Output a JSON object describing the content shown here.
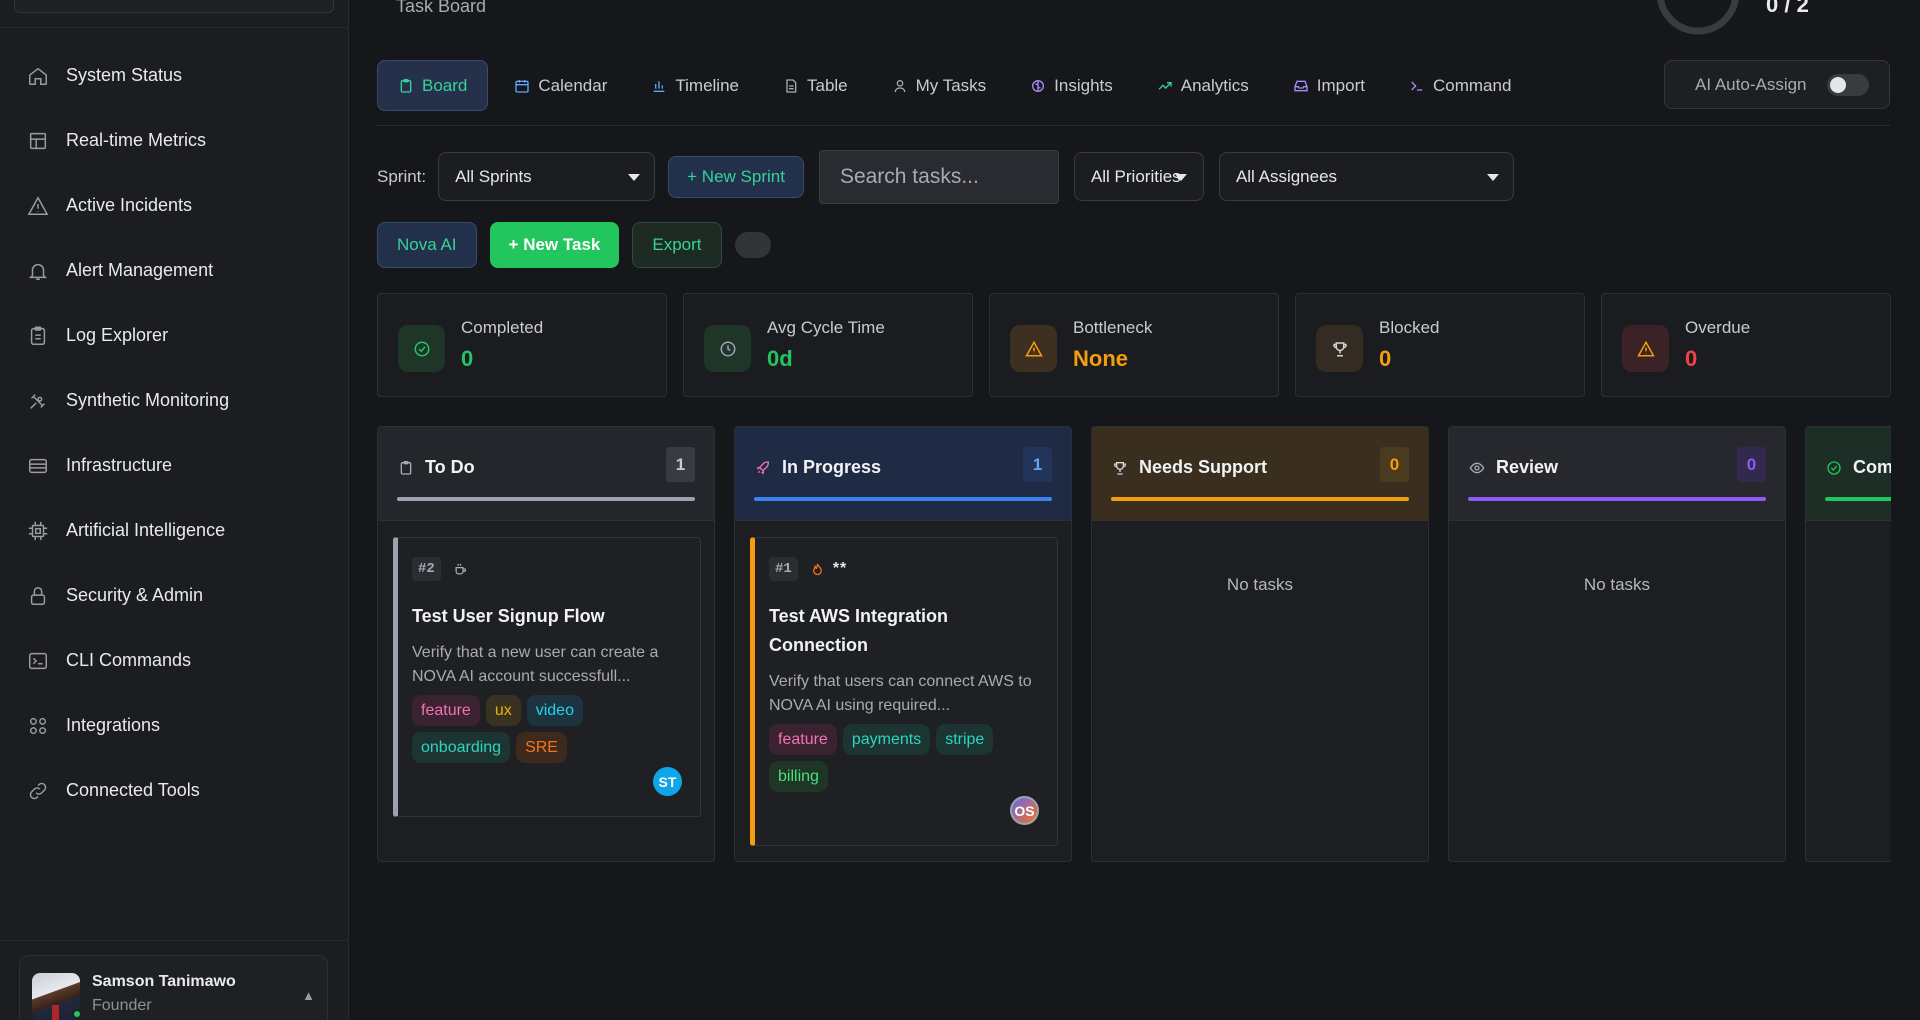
{
  "page": {
    "title": "Task Board",
    "progress_text": "0 / 2",
    "progress_fraction": 0
  },
  "sidebar": {
    "items": [
      {
        "label": "System Status",
        "icon": "home-icon"
      },
      {
        "label": "Real-time Metrics",
        "icon": "layout-icon"
      },
      {
        "label": "Active Incidents",
        "icon": "warning-icon"
      },
      {
        "label": "Alert Management",
        "icon": "bell-icon"
      },
      {
        "label": "Log Explorer",
        "icon": "clipboard-icon"
      },
      {
        "label": "Synthetic Monitoring",
        "icon": "satellite-icon"
      },
      {
        "label": "Infrastructure",
        "icon": "server-icon"
      },
      {
        "label": "Artificial Intelligence",
        "icon": "cpu-icon"
      },
      {
        "label": "Security & Admin",
        "icon": "lock-icon"
      },
      {
        "label": "CLI Commands",
        "icon": "terminal-icon"
      },
      {
        "label": "Integrations",
        "icon": "grid-icon"
      },
      {
        "label": "Connected Tools",
        "icon": "link-icon"
      }
    ],
    "user": {
      "name": "Samson Tanimawo",
      "role": "Founder"
    }
  },
  "tabs": [
    {
      "label": "Board",
      "icon": "clipboard-icon",
      "active": true
    },
    {
      "label": "Calendar",
      "icon": "calendar-icon",
      "active": false
    },
    {
      "label": "Timeline",
      "icon": "bar-chart-icon",
      "active": false
    },
    {
      "label": "Table",
      "icon": "document-icon",
      "active": false
    },
    {
      "label": "My Tasks",
      "icon": "user-icon",
      "active": false
    },
    {
      "label": "Insights",
      "icon": "brain-icon",
      "active": false
    },
    {
      "label": "Analytics",
      "icon": "trend-icon",
      "active": false
    },
    {
      "label": "Import",
      "icon": "inbox-icon",
      "active": false
    },
    {
      "label": "Command",
      "icon": "prompt-icon",
      "active": false
    }
  ],
  "auto_assign": {
    "label": "AI Auto-Assign",
    "enabled": false
  },
  "filters": {
    "sprint_label": "Sprint:",
    "sprint_value": "All Sprints",
    "new_sprint": "+ New Sprint",
    "search_placeholder": "Search tasks...",
    "priority_value": "All Priorities",
    "assignee_value": "All Assignees"
  },
  "actions": {
    "nova": "Nova AI",
    "new_task": "+ New Task",
    "export": "Export"
  },
  "stats": [
    {
      "label": "Completed",
      "value": "0",
      "color": "#22c55e",
      "icon": "check-circle-icon"
    },
    {
      "label": "Avg Cycle Time",
      "value": "0d",
      "color": "#22c55e",
      "icon": "clock-icon"
    },
    {
      "label": "Bottleneck",
      "value": "None",
      "color": "#f59e0b",
      "icon": "warning-icon"
    },
    {
      "label": "Blocked",
      "value": "0",
      "color": "#f59e0b",
      "icon": "trophy-icon"
    },
    {
      "label": "Overdue",
      "value": "0",
      "color": "#ef4444",
      "icon": "warning-icon"
    }
  ],
  "columns": [
    {
      "title": "To Do",
      "count": "1",
      "icon": "clipboard-icon",
      "accent": "#9ca3af"
    },
    {
      "title": "In Progress",
      "count": "1",
      "icon": "rocket-icon",
      "accent": "#3b82f6"
    },
    {
      "title": "Needs Support",
      "count": "0",
      "icon": "trophy-icon",
      "accent": "#f59e0b",
      "empty": "No tasks"
    },
    {
      "title": "Review",
      "count": "0",
      "icon": "eye-icon",
      "accent": "#8b5cf6",
      "empty": "No tasks"
    },
    {
      "title": "Com",
      "count": "",
      "icon": "check-circle-icon",
      "accent": "#22c55e"
    }
  ],
  "cards": [
    {
      "id": "#2",
      "title": "Test User Signup Flow",
      "description": "Verify that a new user can create a NOVA AI account successfull...",
      "tags": [
        "feature",
        "ux",
        "video",
        "onboarding",
        "SRE"
      ],
      "assignee": "ST",
      "marker": "coffee-icon"
    },
    {
      "id": "#1",
      "title": "Test AWS Integration Connection",
      "description": "Verify that users can connect AWS to NOVA AI using required...",
      "tags": [
        "feature",
        "payments",
        "stripe",
        "billing"
      ],
      "assignee": "OS",
      "marker": "flame-icon",
      "stars": "**"
    }
  ]
}
